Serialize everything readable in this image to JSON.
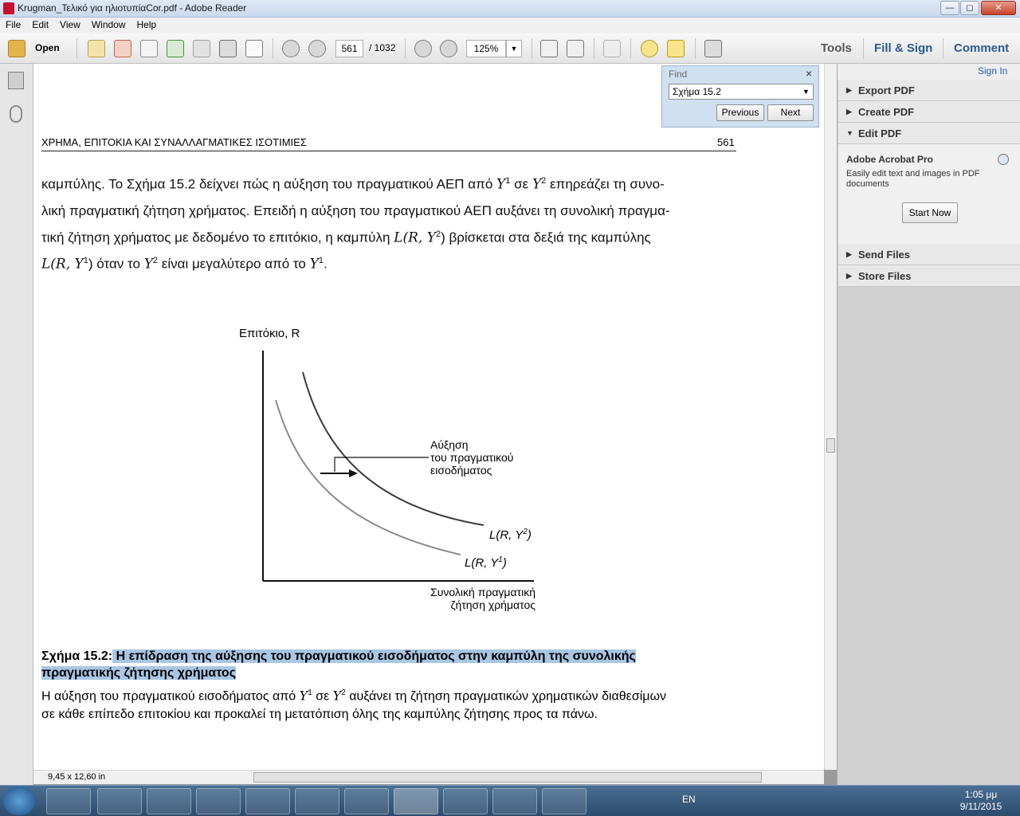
{
  "window": {
    "title": "Krugman_Τελικό για ηλιοτυπίαCor.pdf - Adobe Reader",
    "min": "—",
    "max": "◻",
    "close": "✕"
  },
  "menu": [
    "File",
    "Edit",
    "View",
    "Window",
    "Help"
  ],
  "toolbar": {
    "open_label": "Open",
    "page_current": "561",
    "page_total": "/ 1032",
    "zoom": "125%",
    "tools": "Tools",
    "fill_sign": "Fill & Sign",
    "comment": "Comment"
  },
  "find": {
    "title": "Find",
    "query": "Σχήμα 15.2",
    "previous": "Previous",
    "next": "Next",
    "close": "×"
  },
  "right_panel": {
    "sign_in": "Sign In",
    "export_pdf": "Export PDF",
    "create_pdf": "Create PDF",
    "edit_pdf": "Edit PDF",
    "promo_title": "Adobe Acrobat Pro",
    "promo_text_1": "Easily edit text and images in PDF",
    "promo_text_2": "documents",
    "start_now": "Start Now",
    "send_files": "Send Files",
    "store_files": "Store Files"
  },
  "page": {
    "header_left": "ΧΡΗΜΑ, ΕΠΙΤΟΚΙΑ ΚΑΙ ΣΥΝΑΛΛΑΓΜΑΤΙΚΕΣ ΙΣΟΤΙΜΙΕΣ",
    "header_right": "561",
    "p1_l1_a": "καμπύλης. Το Σχήμα 15.2 δείχνει πώς η αύξηση του πραγματικού ΑΕΠ από ",
    "p1_l1_b": " σε ",
    "p1_l1_c": " επηρεάζει τη συνο-",
    "p1_l2": "λική πραγματική ζήτηση χρήματος. Επειδή η αύξηση του πραγματικού ΑΕΠ αυξάνει τη συνολική πραγμα-",
    "p1_l3_a": "τική ζήτηση χρήματος με δεδομένο το επιτόκιο, η καμπύλη ",
    "p1_l3_b": " βρίσκεται στα δεξιά της καμπύλης",
    "p1_l4_b": " όταν το ",
    "p1_l4_c": " είναι μεγαλύτερο από το ",
    "y1": "Y",
    "sup1": "1",
    "sup2": "2",
    "l_ry2": "L(R, Y",
    "l_ry1": "L(R, Y",
    "close_paren": ")",
    "period": "."
  },
  "figure": {
    "y_axis_label": "Επιτόκιο, R",
    "annotation_1": "Αύξηση",
    "annotation_2": "του πραγματικού",
    "annotation_3": "εισοδήματος",
    "curve2_label_a": "L(R, Y",
    "curve2_sup": "2",
    "curve2_label_b": ")",
    "curve1_label_a": "L(R, Y",
    "curve1_sup": "1",
    "curve1_label_b": ")",
    "x_axis_label_1": "Συνολική πραγματική",
    "x_axis_label_2": "ζήτηση χρήματος"
  },
  "caption": {
    "number": "Σχήμα 15.2:",
    "title_1": " Η επίδραση της αύξησης του πραγματικού εισοδήματος στην καμπύλη της συνολικής",
    "title_2": "πραγματικής ζήτησης χρήματος",
    "body_1_a": "Η αύξηση του πραγματικού εισοδήματος από ",
    "body_1_b": " σε ",
    "body_1_c": " αυξάνει τη ζήτηση πραγματικών χρηματικών διαθεσίμων",
    "body_2": "σε κάθε επίπεδο επιτοκίου και προκαλεί τη μετατόπιση όλης της καμπύλης ζήτησης προς τα πάνω."
  },
  "status": {
    "page_size": "9,45 x 12,60 in"
  },
  "taskbar": {
    "lang": "EN",
    "time": "1:05 μμ",
    "date": "9/11/2015"
  }
}
